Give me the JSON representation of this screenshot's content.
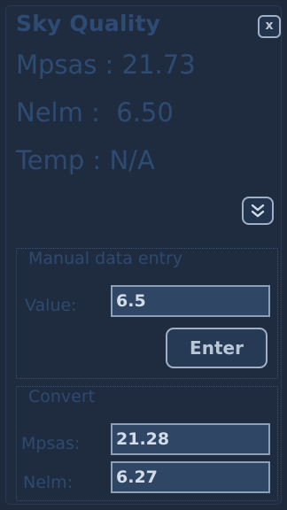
{
  "window": {
    "title": "Sky Quality",
    "close_label": "x"
  },
  "readings": {
    "mpsas": "Mpsas : 21.73",
    "nelm": "Nelm :  6.50",
    "temp": "Temp : N/A"
  },
  "manual_entry": {
    "legend": "Manual data entry",
    "value_label": "Value:",
    "value": "6.5",
    "enter_label": "Enter"
  },
  "convert": {
    "legend": "Convert",
    "mpsas_label": "Mpsas:",
    "mpsas_value": "21.28",
    "nelm_label": "Nelm:",
    "nelm_value": "6.27"
  },
  "icons": {
    "close": "close-icon",
    "expand": "double-chevron-down-icon"
  }
}
